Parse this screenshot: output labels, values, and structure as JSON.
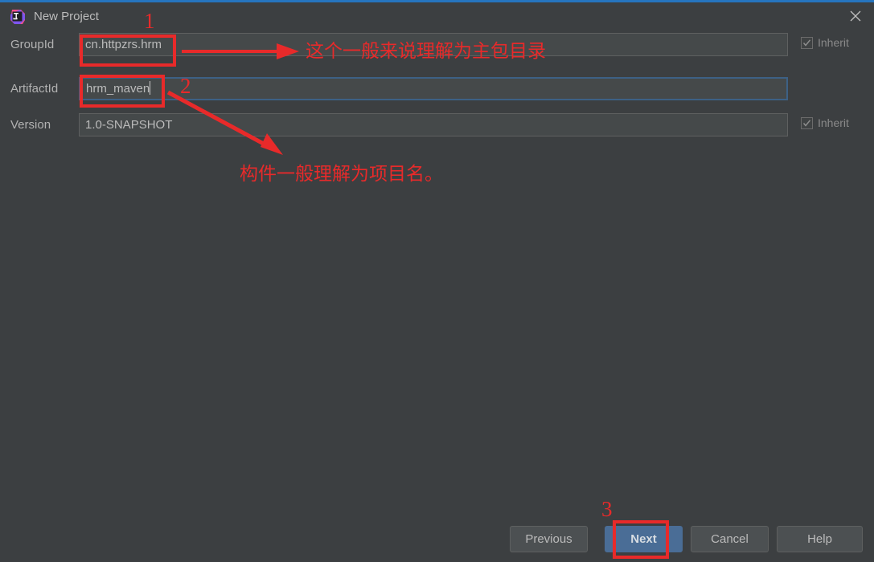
{
  "window": {
    "title": "New Project",
    "app_icon": "intellij-idea-icon",
    "close_icon": "close-icon",
    "accent_color": "#2675bf",
    "background_color": "#3c3f41"
  },
  "form": {
    "rows": [
      {
        "label": "GroupId",
        "value": "cn.httpzrs.hrm",
        "placeholder": "",
        "focused": false,
        "caret": false,
        "inherit": {
          "label": "Inherit",
          "checked": true
        }
      },
      {
        "label": "ArtifactId",
        "value": "hrm_maven",
        "placeholder": "",
        "focused": true,
        "caret": true,
        "inherit": null
      },
      {
        "label": "Version",
        "value": "1.0-SNAPSHOT",
        "placeholder": "",
        "focused": false,
        "caret": false,
        "inherit": {
          "label": "Inherit",
          "checked": true
        }
      }
    ]
  },
  "buttons": [
    {
      "label": "Previous",
      "primary": false
    },
    {
      "label": "Next",
      "primary": true
    },
    {
      "label": "Cancel",
      "primary": false
    },
    {
      "label": "Help",
      "primary": false
    }
  ],
  "annotations": {
    "color": "#e82a2a",
    "numbers": [
      {
        "text": "1"
      },
      {
        "text": "2"
      },
      {
        "text": "3"
      }
    ],
    "notes": [
      {
        "text": "这个一般来说理解为主包目录"
      },
      {
        "text": "构件一般理解为项目名。"
      }
    ]
  }
}
